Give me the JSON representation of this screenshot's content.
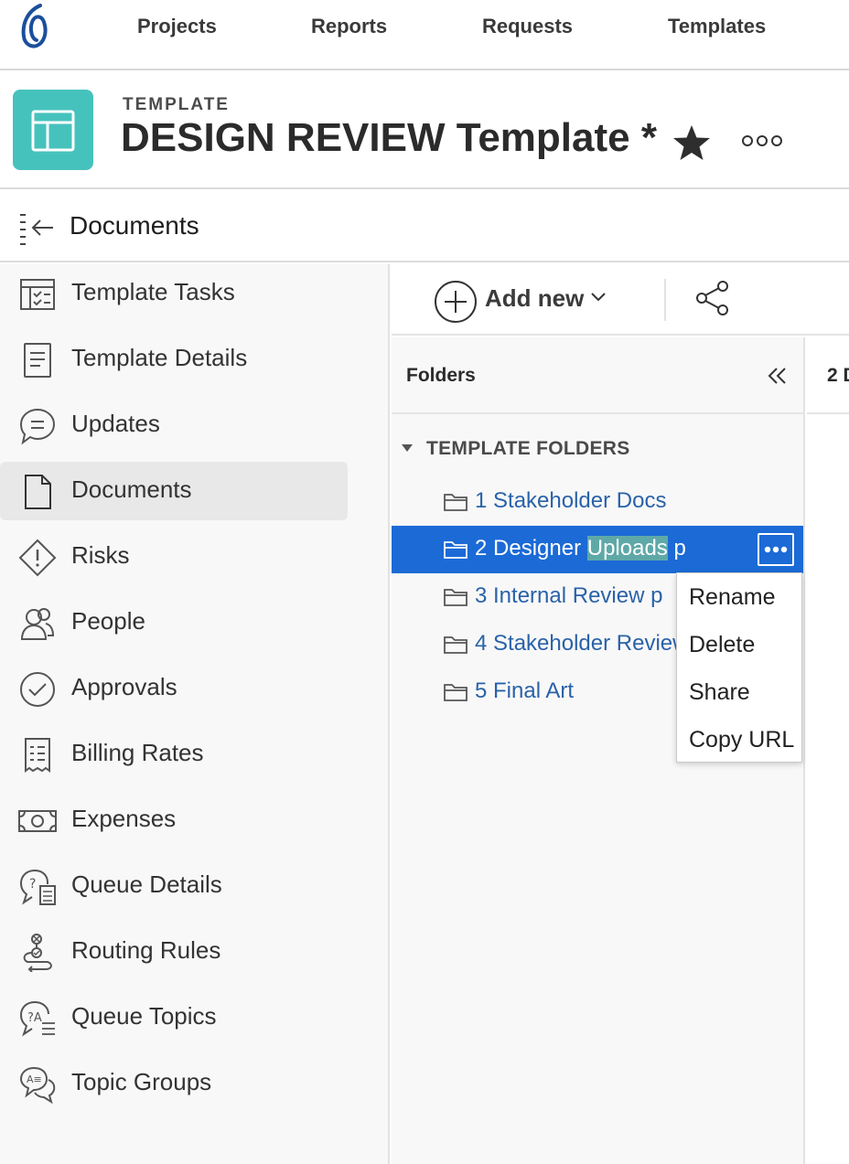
{
  "topnav": {
    "links": [
      "Projects",
      "Reports",
      "Requests",
      "Templates"
    ]
  },
  "header": {
    "kicker": "TEMPLATE",
    "title": "DESIGN REVIEW Template *",
    "icon": "template-layout-icon",
    "accent": "#46c2bd"
  },
  "section": {
    "title": "Documents"
  },
  "sidebar": {
    "items": [
      {
        "label": "Template Tasks",
        "icon": "task-list-icon"
      },
      {
        "label": "Template Details",
        "icon": "details-document-icon"
      },
      {
        "label": "Updates",
        "icon": "chat-bubble-icon"
      },
      {
        "label": "Documents",
        "icon": "document-icon",
        "active": true
      },
      {
        "label": "Risks",
        "icon": "risk-diamond-icon"
      },
      {
        "label": "People",
        "icon": "people-icon"
      },
      {
        "label": "Approvals",
        "icon": "check-circle-icon"
      },
      {
        "label": "Billing Rates",
        "icon": "receipt-icon"
      },
      {
        "label": "Expenses",
        "icon": "money-bill-icon"
      },
      {
        "label": "Queue Details",
        "icon": "queue-question-icon"
      },
      {
        "label": "Routing Rules",
        "icon": "routing-icon"
      },
      {
        "label": "Queue Topics",
        "icon": "queue-topics-icon"
      },
      {
        "label": "Topic Groups",
        "icon": "topic-groups-icon"
      }
    ]
  },
  "toolbar": {
    "add_new_label": "Add new"
  },
  "folders": {
    "title": "Folders",
    "group_label": "TEMPLATE FOLDERS",
    "items": [
      {
        "label": "1 Stakeholder Docs"
      },
      {
        "label_pre": "2 Designer ",
        "label_hl": "Uploads",
        "label_post": " p",
        "selected": true
      },
      {
        "label": "3 Internal Review p"
      },
      {
        "label": "4 Stakeholder Review"
      },
      {
        "label": "5 Final Art"
      }
    ],
    "selected_color": "#1b6ad6"
  },
  "context_menu": {
    "items": [
      "Rename",
      "Delete",
      "Share",
      "Copy URL"
    ]
  },
  "right_pane": {
    "label": "2 D"
  }
}
